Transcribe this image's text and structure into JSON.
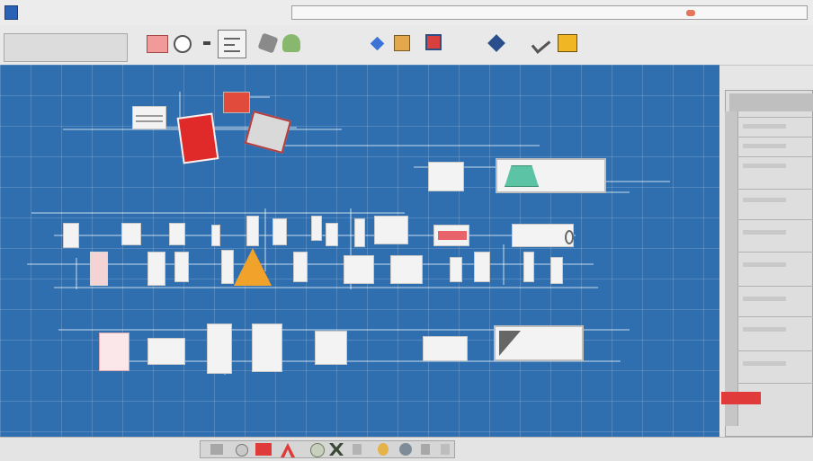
{
  "window": {
    "title": "",
    "brand_color": "#2f6fb0"
  },
  "toolbar": {
    "left_label": "",
    "label_a": "",
    "label_b": "",
    "label_c": ""
  },
  "canvas": {
    "labels": {
      "left_top": "",
      "left_mid": "",
      "top_right": "",
      "right_mid": "",
      "right_low": "",
      "right_row": "",
      "bottom_right": "",
      "bottom_mid": ""
    },
    "node_texts": {
      "top_right_card": "",
      "right_card_mid": "",
      "pink_card": ""
    }
  },
  "side_panel": {
    "title": "",
    "footer": ""
  },
  "icons": [
    "app-window-icon",
    "close-icon",
    "shape-rectangle-icon",
    "shape-circle-icon",
    "diagram-icon",
    "gem-icon",
    "tree-icon",
    "diamond-icon",
    "package-icon",
    "monitor-icon",
    "pen-icon",
    "checkmark-icon",
    "folder-icon"
  ]
}
